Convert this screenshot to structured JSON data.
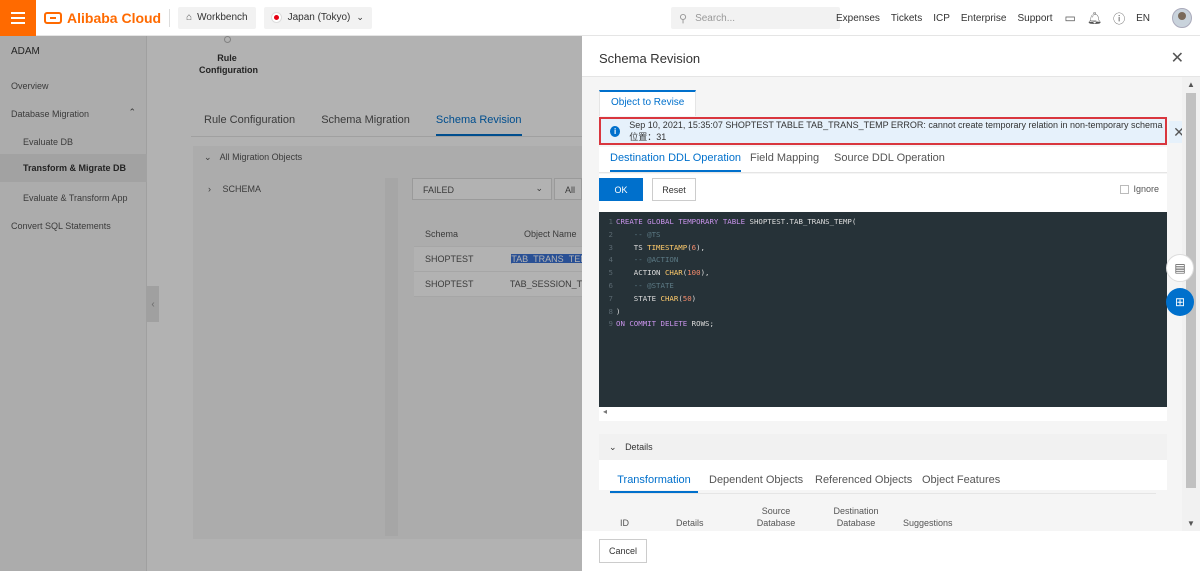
{
  "topbar": {
    "brand": "Alibaba Cloud",
    "workbench": "Workbench",
    "region": "Japan (Tokyo)",
    "search_placeholder": "Search...",
    "links": [
      "Expenses",
      "Tickets",
      "ICP",
      "Enterprise",
      "Support"
    ],
    "lang": "EN"
  },
  "sidebar": {
    "title": "ADAM",
    "items": [
      "Overview",
      "Database Migration",
      "Evaluate DB",
      "Transform & Migrate DB",
      "Evaluate & Transform App",
      "Convert SQL Statements"
    ]
  },
  "main": {
    "step_label": "Rule Configuration",
    "tabs": [
      "Rule Configuration",
      "Schema Migration",
      "Schema Revision"
    ],
    "all_objects": "All Migration Objects",
    "tree_item": "SCHEMA",
    "filter_status": "FAILED",
    "filter_all": "All",
    "table_headers": [
      "Schema",
      "Object Name"
    ],
    "rows": [
      {
        "schema": "SHOPTEST",
        "name": "TAB_TRANS_TEMP"
      },
      {
        "schema": "SHOPTEST",
        "name": "TAB_SESSION_TEM"
      }
    ]
  },
  "drawer": {
    "title": "Schema Revision",
    "object_tab": "Object to Revise",
    "error": "Sep 10, 2021, 15:35:07 SHOPTEST TABLE TAB_TRANS_TEMP ERROR: cannot create temporary relation in non-temporary schema 位置：31",
    "ddl_tabs": [
      "Destination DDL Operation",
      "Field Mapping",
      "Source DDL Operation"
    ],
    "ok": "OK",
    "reset": "Reset",
    "ignore": "Ignore",
    "details": "Details",
    "detail_tabs": [
      "Transformation",
      "Dependent Objects",
      "Referenced Objects",
      "Object Features"
    ],
    "detail_columns": [
      "ID",
      "Details",
      "Source Database",
      "Destination Database",
      "Suggestions"
    ],
    "cancel": "Cancel"
  },
  "code_lines": [
    "CREATE GLOBAL TEMPORARY TABLE SHOPTEST.TAB_TRANS_TEMP(",
    "    -- @TS",
    "    TS TIMESTAMP(6),",
    "    -- @ACTION",
    "    ACTION CHAR(100),",
    "    -- @STATE",
    "    STATE CHAR(50)",
    ")",
    "ON COMMIT DELETE ROWS;"
  ],
  "colors": {
    "accent": "#0070cc",
    "brand": "#ff6a00",
    "error_border": "#d9363e",
    "code_bg": "#263238"
  }
}
